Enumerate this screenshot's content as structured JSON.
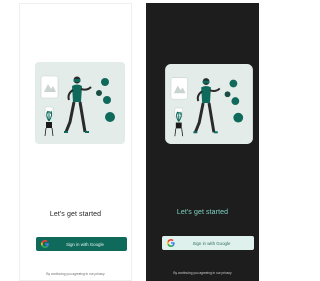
{
  "screens": [
    {
      "theme": "light",
      "title": "Let's get started",
      "google_button_label": "Sign in with Google",
      "disclaimer": "By continuing you agreeing in our privacy"
    },
    {
      "theme": "dark",
      "title": "Let's get started",
      "google_button_label": "Sign in with Google",
      "disclaimer": "By continuing you agreeing in our privacy"
    }
  ],
  "colors": {
    "brand_green": "#0f6a5b",
    "dark_background": "#1d1d1d",
    "dark_accent_text": "#7fd4c1",
    "dark_button_bg": "#dff1ec",
    "illustration_card": "#e3ece8"
  },
  "icons": [
    "vr-illustration",
    "google-icon"
  ]
}
